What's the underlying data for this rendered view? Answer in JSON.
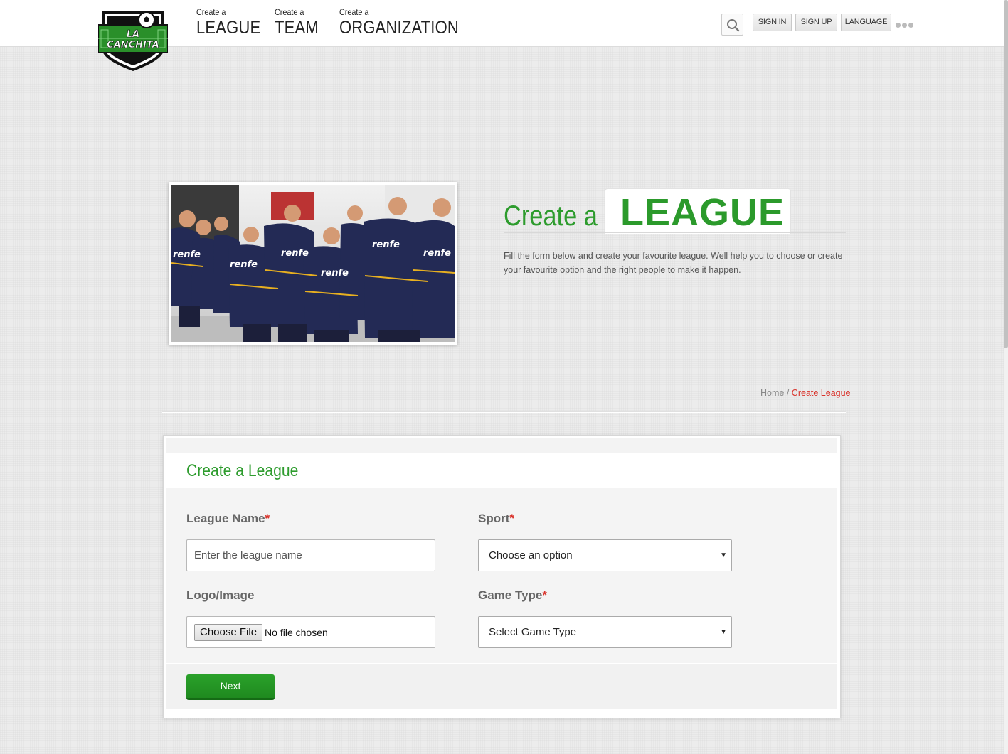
{
  "brand": {
    "logo_text_line1": "LA",
    "logo_text_line2": "CANCHITA",
    "colors": {
      "green": "#2e9c2e",
      "red": "#d9322a"
    }
  },
  "nav": [
    {
      "small": "Create a",
      "big": "LEAGUE"
    },
    {
      "small": "Create a",
      "big": "TEAM"
    },
    {
      "small": "Create a",
      "big": "ORGANIZATION"
    }
  ],
  "header_actions": {
    "search_icon": "search-icon",
    "sign_in": "SIGN IN",
    "sign_up": "SIGN UP",
    "language": "LANGUAGE",
    "more_icon": "more-dots-icon"
  },
  "hero": {
    "create_a": "Create a",
    "league": "LEAGUE",
    "description": "Fill the form below and create your favourite league. Well help you to choose or create your favourite option and the right people to make it happen.",
    "photo_jersey_text": "renfe"
  },
  "breadcrumb": {
    "home": "Home",
    "separator": "/",
    "current": "Create League"
  },
  "form": {
    "title": "Create a League",
    "league_name": {
      "label": "League Name",
      "required": "*",
      "placeholder": "Enter the league name"
    },
    "sport": {
      "label": "Sport",
      "required": "*",
      "selected": "Choose an option"
    },
    "logo": {
      "label": "Logo/Image",
      "button": "Choose File",
      "status": "No file chosen"
    },
    "game_type": {
      "label": "Game Type",
      "required": "*",
      "selected": "Select Game Type"
    },
    "next": "Next"
  }
}
